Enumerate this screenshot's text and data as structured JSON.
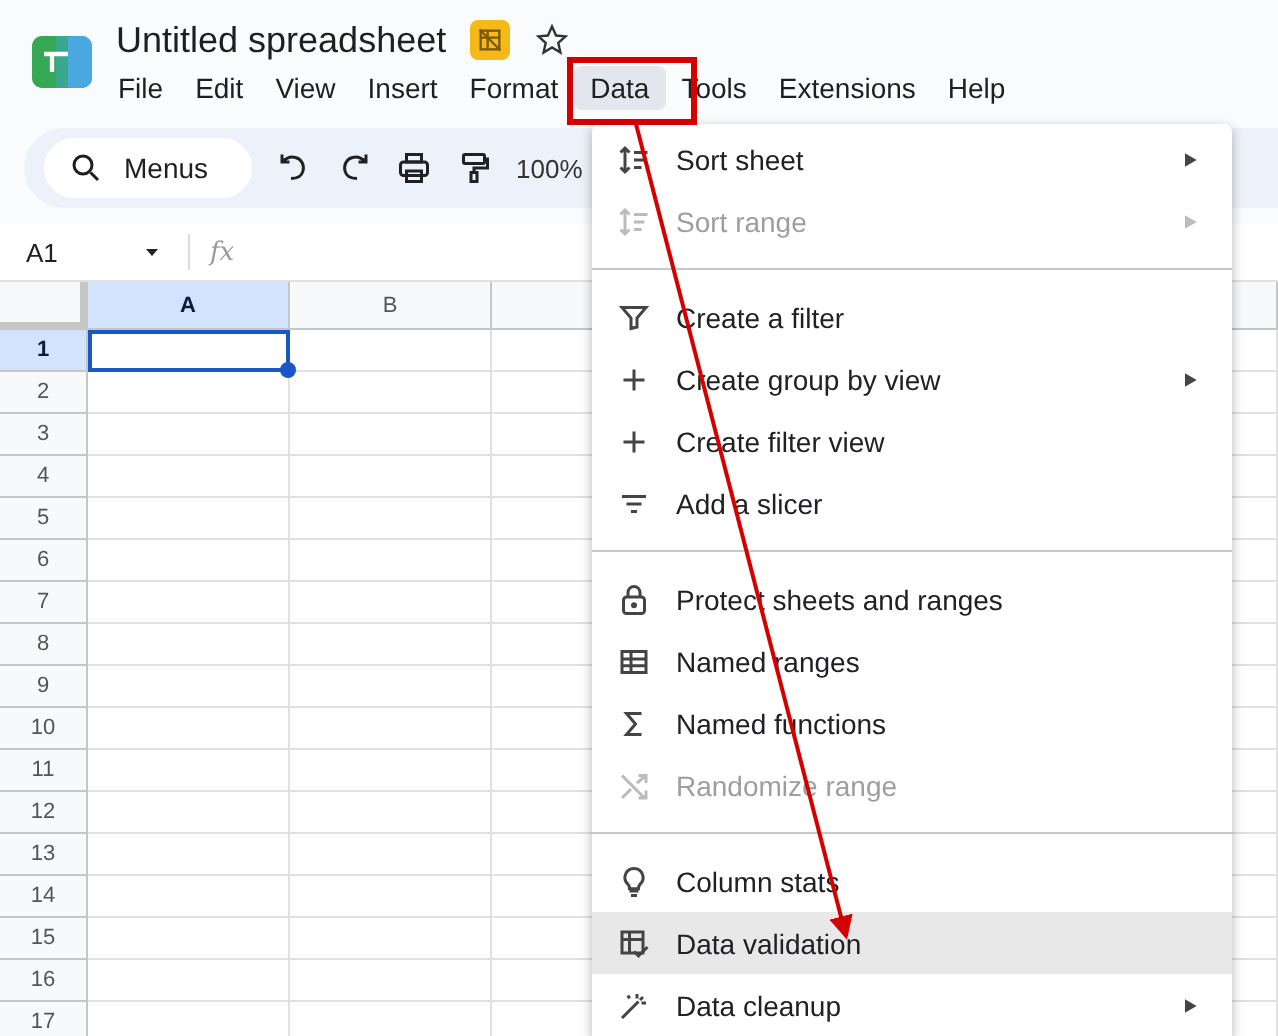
{
  "document": {
    "title": "Untitled spreadsheet"
  },
  "menubar": [
    {
      "label": "File",
      "selected": false
    },
    {
      "label": "Edit",
      "selected": false
    },
    {
      "label": "View",
      "selected": false
    },
    {
      "label": "Insert",
      "selected": false
    },
    {
      "label": "Format",
      "selected": false
    },
    {
      "label": "Data",
      "selected": true
    },
    {
      "label": "Tools",
      "selected": false
    },
    {
      "label": "Extensions",
      "selected": false
    },
    {
      "label": "Help",
      "selected": false
    }
  ],
  "toolbar": {
    "search": "Menus",
    "zoom": "100%"
  },
  "formula_bar": {
    "cell_reference": "A1",
    "function_label": "fx"
  },
  "grid": {
    "columns": [
      {
        "label": "A",
        "selected": true
      },
      {
        "label": "B",
        "selected": false
      }
    ],
    "rows": [
      {
        "label": "1",
        "selected": true
      },
      {
        "label": "2",
        "selected": false
      },
      {
        "label": "3",
        "selected": false
      },
      {
        "label": "4",
        "selected": false
      },
      {
        "label": "5",
        "selected": false
      },
      {
        "label": "6",
        "selected": false
      },
      {
        "label": "7",
        "selected": false
      },
      {
        "label": "8",
        "selected": false
      },
      {
        "label": "9",
        "selected": false
      },
      {
        "label": "10",
        "selected": false
      },
      {
        "label": "11",
        "selected": false
      },
      {
        "label": "12",
        "selected": false
      },
      {
        "label": "13",
        "selected": false
      },
      {
        "label": "14",
        "selected": false
      },
      {
        "label": "15",
        "selected": false
      },
      {
        "label": "16",
        "selected": false
      },
      {
        "label": "17",
        "selected": false
      }
    ]
  },
  "data_menu": [
    {
      "kind": "item",
      "label": "Sort sheet",
      "disabled": false,
      "submenu": true,
      "selected": false
    },
    {
      "kind": "item",
      "label": "Sort range",
      "disabled": true,
      "submenu": true,
      "selected": false
    },
    {
      "kind": "divider"
    },
    {
      "kind": "item",
      "label": "Create a filter",
      "disabled": false,
      "submenu": false,
      "selected": false
    },
    {
      "kind": "item",
      "label": "Create group by view",
      "disabled": false,
      "submenu": true,
      "selected": false
    },
    {
      "kind": "item",
      "label": "Create filter view",
      "disabled": false,
      "submenu": false,
      "selected": false
    },
    {
      "kind": "item",
      "label": "Add a slicer",
      "disabled": false,
      "submenu": false,
      "selected": false
    },
    {
      "kind": "divider"
    },
    {
      "kind": "item",
      "label": "Protect sheets and ranges",
      "disabled": false,
      "submenu": false,
      "selected": false
    },
    {
      "kind": "item",
      "label": "Named ranges",
      "disabled": false,
      "submenu": false,
      "selected": false
    },
    {
      "kind": "item",
      "label": "Named functions",
      "disabled": false,
      "submenu": false,
      "selected": false
    },
    {
      "kind": "item",
      "label": "Randomize range",
      "disabled": true,
      "submenu": false,
      "selected": false
    },
    {
      "kind": "divider"
    },
    {
      "kind": "item",
      "label": "Column stats",
      "disabled": false,
      "submenu": false,
      "selected": false
    },
    {
      "kind": "item",
      "label": "Data validation",
      "disabled": false,
      "submenu": false,
      "selected": true
    },
    {
      "kind": "item",
      "label": "Data cleanup",
      "disabled": false,
      "submenu": true,
      "selected": false
    }
  ]
}
